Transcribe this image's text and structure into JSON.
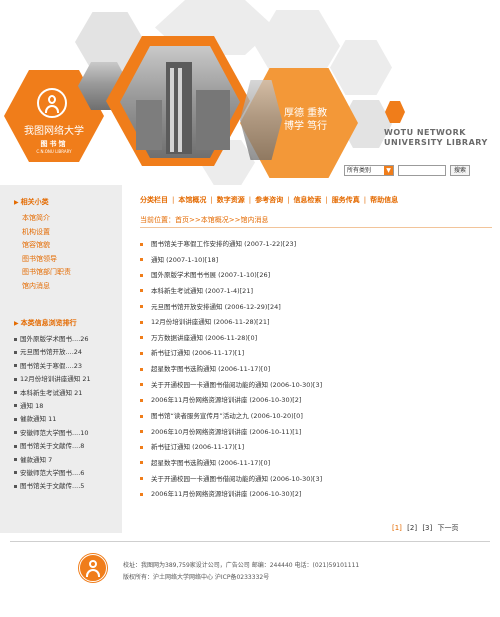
{
  "banner": {
    "university_name": "我图网络大学",
    "library_name": "图书馆",
    "library_sub": "C.N.ONU LIBRARY",
    "motto_line1": "厚德 重教",
    "motto_line2": "博学 笃行",
    "brand_line1": "WOTU NETWORK",
    "brand_line2": "UNIVERSITY LIBRARY",
    "colors": {
      "accent": "#f07d1a",
      "grey": "#ececec"
    }
  },
  "search": {
    "category_value": "所有类别",
    "input_value": "",
    "button_label": "搜索"
  },
  "sidebar": {
    "related_title": "相关小类",
    "related_items": [
      "本馆简介",
      "机构设置",
      "馆容馆貌",
      "图书馆领导",
      "图书馆部门职责",
      "馆内消息"
    ],
    "ranking_title": "本类信息浏览排行",
    "ranking_items": [
      "国外原版学术图书....26",
      "元旦图书馆开放....24",
      "图书馆关于寒假....23",
      "12月份培训讲座通知 21",
      "本科新生考试通知 21",
      "通知 18",
      "催款通知 11",
      "安徽师范大学图书....10",
      "图书馆关于文献传....8",
      "催款通知 7",
      "安徽师范大学图书....6",
      "图书馆关于文献传....5"
    ]
  },
  "nav": {
    "items": [
      "分类栏目",
      "本馆概况",
      "数字资源",
      "参考咨询",
      "信息检索",
      "服务传真",
      "帮助信息"
    ],
    "separator": "|"
  },
  "breadcrumb": "当前位置：首页>>本馆概况>>馆内消息",
  "news": [
    "图书馆关于寒假工作安排的通知 (2007-1-22)[23]",
    "通知 (2007-1-10)[18]",
    "国外原版学术图书书展 (2007-1-10)[26]",
    "本科新生考试通知 (2007-1-4)[21]",
    "元旦图书馆开放安排通知 (2006-12-29)[24]",
    "12月份培训讲座通知 (2006-11-28)[21]",
    "万方数据讲座通知 (2006-11-28)[0]",
    "新书征订通知 (2006-11-17)[1]",
    "超星数字图书选购通知 (2006-11-17)[0]",
    "关于开通校园一卡通图书借阅功能的通知 (2006-10-30)[3]",
    "2006年11月份网络资源培训讲座 (2006-10-30)[2]",
    "图书馆“读者服务宣传月”活动之九 (2006-10-20)[0]",
    "2006年10月份网络资源培训讲座 (2006-10-11)[1]",
    "新书征订通知 (2006-11-17)[1]",
    "超星数字图书选购通知 (2006-11-17)[0]",
    "关于开通校园一卡通图书借阅功能的通知 (2006-10-30)[3]",
    "2006年11月份网络资源培训讲座 (2006-10-30)[2]"
  ],
  "pager": {
    "page1": "[1]",
    "page2": "[2]",
    "page3": "[3]",
    "next": "下一页"
  },
  "footer": {
    "line1": "校址：我图网为389,759家设计公司，广告公司   邮编：244440   电话：(021)59101111",
    "line2": "版权所有：沪土网络大学网络中心   沪ICP备0233332号"
  }
}
